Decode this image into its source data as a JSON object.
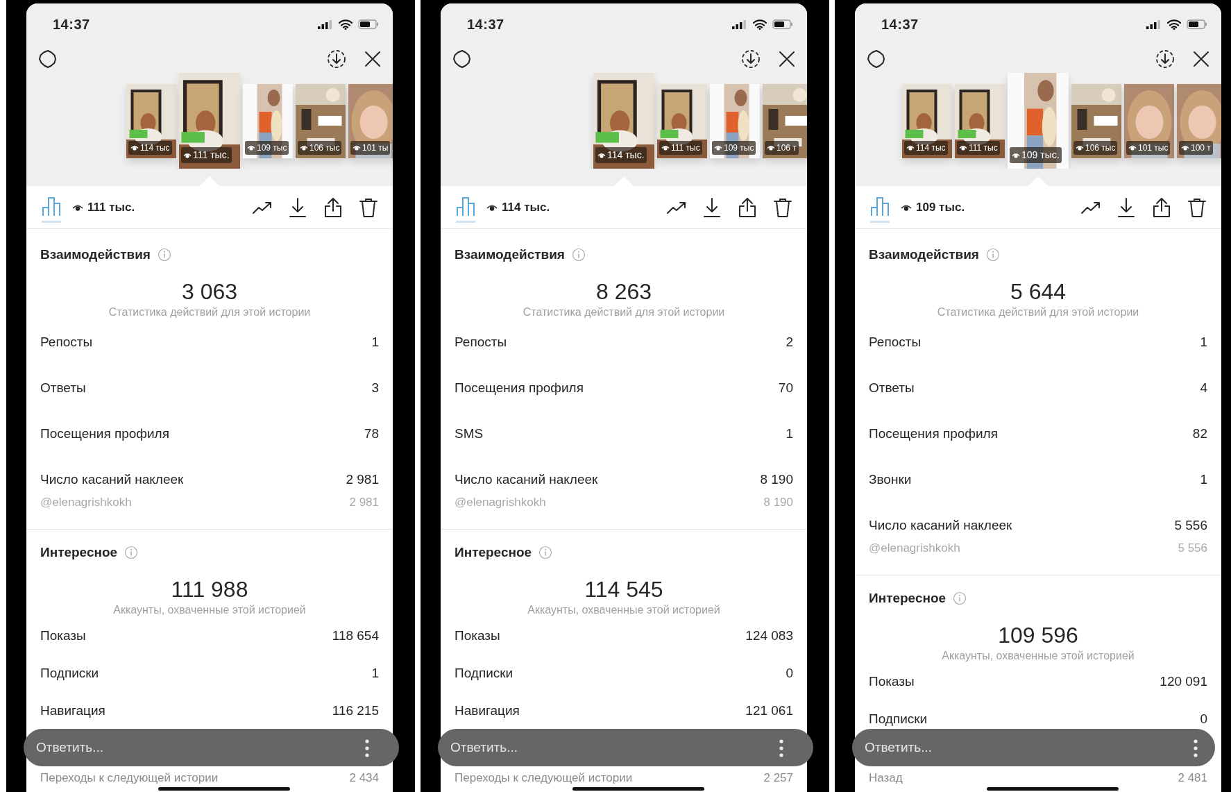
{
  "phones": [
    {
      "status_time": "14:37",
      "thumbnails": [
        {
          "views": "114 тыс",
          "selected": false
        },
        {
          "views": "111 тыс.",
          "selected": true
        },
        {
          "views": "109 тыс",
          "selected": false
        },
        {
          "views": "106 тыс",
          "selected": false
        },
        {
          "views": "101 ты",
          "selected": false
        }
      ],
      "insights_tab": {
        "selected": true
      },
      "views": "111 тыс.",
      "sections": [
        {
          "title": "Взаимодействия",
          "total": "3 063",
          "caption": "Статистика действий для этой истории",
          "rows": [
            {
              "kind": "metric",
              "label": "Репосты",
              "value": "1"
            },
            {
              "kind": "metric",
              "label": "Ответы",
              "value": "3"
            },
            {
              "kind": "metric",
              "label": "Посещения профиля",
              "value": "78"
            },
            {
              "kind": "metric",
              "label": "Число касаний наклеек",
              "value": "2 981"
            },
            {
              "kind": "sub",
              "label": "@elenagrishkokh",
              "value": "2 981"
            }
          ]
        },
        {
          "title": "Интересное",
          "total": "111 988",
          "caption": "Аккаунты, охваченные этой историей",
          "rows": [
            {
              "kind": "metric",
              "label": "Показы",
              "value": "118 654"
            },
            {
              "kind": "metric",
              "label": "Подписки",
              "value": "1"
            },
            {
              "kind": "metric",
              "label": "Навигация",
              "value": "116 215"
            }
          ]
        }
      ],
      "footer_row": {
        "label": "Переходы к следующей истории",
        "value": "2 434"
      },
      "reply_placeholder": "Ответить..."
    },
    {
      "status_time": "14:37",
      "thumbnails": [
        {
          "views": "114 тыс.",
          "selected": true
        },
        {
          "views": "111 тыс",
          "selected": false
        },
        {
          "views": "109 тыс",
          "selected": false
        },
        {
          "views": "106 т",
          "selected": false
        }
      ],
      "insights_tab": {
        "selected": true
      },
      "views": "114 тыс.",
      "sections": [
        {
          "title": "Взаимодействия",
          "total": "8 263",
          "caption": "Статистика действий для этой истории",
          "rows": [
            {
              "kind": "metric",
              "label": "Репосты",
              "value": "2"
            },
            {
              "kind": "metric",
              "label": "Посещения профиля",
              "value": "70"
            },
            {
              "kind": "metric",
              "label": "SMS",
              "value": "1"
            },
            {
              "kind": "metric",
              "label": "Число касаний наклеек",
              "value": "8 190"
            },
            {
              "kind": "sub",
              "label": "@elenagrishkokh",
              "value": "8 190"
            }
          ]
        },
        {
          "title": "Интересное",
          "total": "114 545",
          "caption": "Аккаунты, охваченные этой историей",
          "rows": [
            {
              "kind": "metric",
              "label": "Показы",
              "value": "124 083"
            },
            {
              "kind": "metric",
              "label": "Подписки",
              "value": "0"
            },
            {
              "kind": "metric",
              "label": "Навигация",
              "value": "121 061"
            }
          ]
        }
      ],
      "footer_row": {
        "label": "Переходы к следующей истории",
        "value": "2 257"
      },
      "reply_placeholder": "Ответить..."
    },
    {
      "status_time": "14:37",
      "thumbnails": [
        {
          "views": "114 тыс",
          "selected": false
        },
        {
          "views": "111 тыс",
          "selected": false
        },
        {
          "views": "109 тыс.",
          "selected": true
        },
        {
          "views": "106 тыс",
          "selected": false
        },
        {
          "views": "101 тыс",
          "selected": false
        },
        {
          "views": "100 т",
          "selected": false
        }
      ],
      "insights_tab": {
        "selected": true
      },
      "views": "109 тыс.",
      "sections": [
        {
          "title": "Взаимодействия",
          "total": "5 644",
          "caption": "Статистика действий для этой истории",
          "rows": [
            {
              "kind": "metric",
              "label": "Репосты",
              "value": "1"
            },
            {
              "kind": "metric",
              "label": "Ответы",
              "value": "4"
            },
            {
              "kind": "metric",
              "label": "Посещения профиля",
              "value": "82"
            },
            {
              "kind": "metric",
              "label": "Звонки",
              "value": "1"
            },
            {
              "kind": "metric",
              "label": "Число касаний наклеек",
              "value": "5 556"
            },
            {
              "kind": "sub",
              "label": "@elenagrishkokh",
              "value": "5 556"
            }
          ]
        },
        {
          "title": "Интересное",
          "total": "109 596",
          "caption": "Аккаунты, охваченные этой историей",
          "rows": [
            {
              "kind": "metric",
              "label": "Показы",
              "value": "120 091"
            },
            {
              "kind": "metric",
              "label": "Подписки",
              "value": "0"
            }
          ]
        }
      ],
      "footer_row": {
        "label": "Назад",
        "value": "2 481"
      },
      "reply_placeholder": "Ответить..."
    }
  ]
}
